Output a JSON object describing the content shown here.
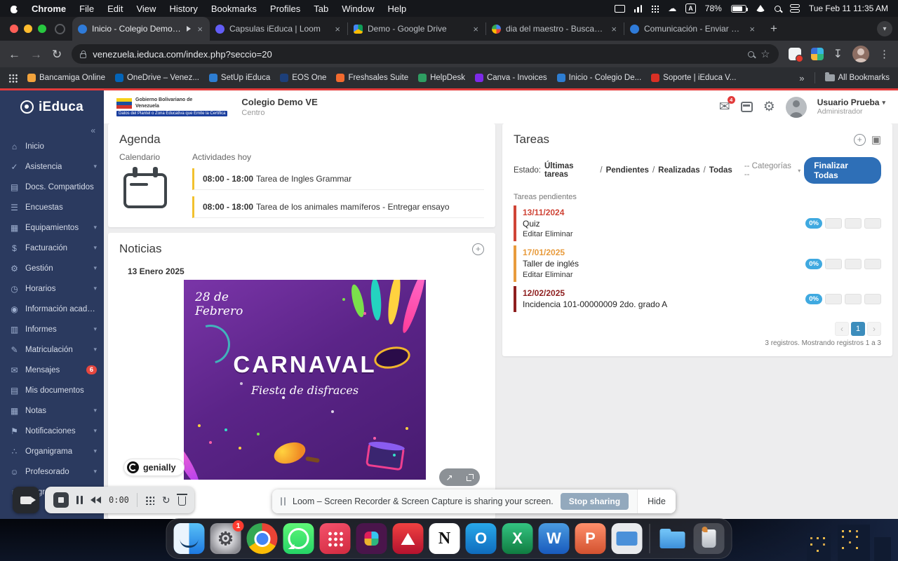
{
  "icons": {
    "caret_down": "▾",
    "more_chevrons": "»",
    "back_arrow": "←",
    "forward_arrow": "→",
    "reload": "↻",
    "star": "☆",
    "download": "↧",
    "kebab": "⋮",
    "plus": "+",
    "close": "×",
    "mail": "✉",
    "gear": "⚙",
    "chevron_left": "‹",
    "chevron_right": "›",
    "collapse": "«",
    "share": "↗",
    "slash": "/",
    "cloud": "☁",
    "refresh": "↻"
  },
  "menubar": {
    "app": "Chrome",
    "menus": [
      "File",
      "Edit",
      "View",
      "History",
      "Bookmarks",
      "Profiles",
      "Tab",
      "Window",
      "Help"
    ],
    "input_source": "A",
    "battery": "78%",
    "clock": "Tue Feb 11 11:35 AM"
  },
  "tabstrip": {
    "tabs": [
      {
        "title": "Inicio - Colegio Demo VE"
      },
      {
        "title": "Capsulas iEduca | Loom"
      },
      {
        "title": "Demo - Google Drive"
      },
      {
        "title": "dia del maestro - Buscar con"
      },
      {
        "title": "Comunicación - Enviar Mens"
      }
    ]
  },
  "toolbar": {
    "url": "venezuela.ieduca.com/index.php?seccio=20"
  },
  "bookmarks": {
    "items": [
      "Bancamiga Online",
      "OneDrive – Venez...",
      "SetUp iEduca",
      "EOS One",
      "Freshsales Suite",
      "HelpDesk",
      "Canva - Invoices",
      "Inicio - Colegio De...",
      "Soporte | iEduca V..."
    ],
    "all": "All Bookmarks"
  },
  "app_header": {
    "logo": "iEduca",
    "gov_title": "Gobierno Bolivariano de Venezuela",
    "gov_subtitle": "Datos del Plantel o Zona Educativa que Emite la Certifica",
    "school_name": "Colegio Demo VE",
    "school_type": "Centro",
    "mail_badge": "4",
    "user_name": "Usuario Prueba",
    "user_role": "Administrador"
  },
  "sidebar": {
    "items": [
      {
        "label": "Inicio",
        "icon": "⌂"
      },
      {
        "label": "Asistencia",
        "icon": "✓"
      },
      {
        "label": "Docs. Compartidos",
        "icon": "▤"
      },
      {
        "label": "Encuestas",
        "icon": "☰"
      },
      {
        "label": "Equipamientos",
        "icon": "▦"
      },
      {
        "label": "Facturación",
        "icon": "$"
      },
      {
        "label": "Gestión",
        "icon": "⚙"
      },
      {
        "label": "Horarios",
        "icon": "◷"
      },
      {
        "label": "Información académica",
        "icon": "◉"
      },
      {
        "label": "Informes",
        "icon": "▥"
      },
      {
        "label": "Matriculación",
        "icon": "✎"
      },
      {
        "label": "Mensajes",
        "icon": "✉",
        "badge": "6"
      },
      {
        "label": "Mis documentos",
        "icon": "▤"
      },
      {
        "label": "Notas",
        "icon": "▦"
      },
      {
        "label": "Notificaciones",
        "icon": "⚑"
      },
      {
        "label": "Organigrama",
        "icon": "∴"
      },
      {
        "label": "Profesorado",
        "icon": "☺"
      },
      {
        "label": "Programación",
        "icon": "≡"
      }
    ]
  },
  "agenda": {
    "title": "Agenda",
    "tab_calendar": "Calendario",
    "tab_today": "Actividades hoy",
    "events": [
      {
        "time": "08:00 - 18:00",
        "text": "Tarea de Ingles Grammar"
      },
      {
        "time": "08:00 - 18:00",
        "text": "Tarea de los animales mamíferos - Entregar ensayo"
      }
    ]
  },
  "noticias": {
    "title": "Noticias",
    "date": "13 Enero 2025",
    "poster": {
      "line1": "28 de Febrero",
      "line2": "CARNAVAL",
      "line3": "Fiesta de disfraces",
      "brand": "genially"
    }
  },
  "tareas": {
    "title": "Tareas",
    "estado_label": "Estado:",
    "filters": [
      "Últimas tareas",
      "Pendientes",
      "Realizadas",
      "Todas"
    ],
    "categorias": "-- Categorías --",
    "finalizar": "Finalizar Todas",
    "pendientes_label": "Tareas pendientes",
    "rows": [
      {
        "date": "13/11/2024",
        "title": "Quiz",
        "actions": "Editar Eliminar",
        "progress": "0%",
        "color": "#cf4436"
      },
      {
        "date": "17/01/2025",
        "title": "Taller de inglés",
        "actions": "Editar Eliminar",
        "progress": "0%",
        "color": "#e89b3c"
      },
      {
        "date": "12/02/2025",
        "title": "Incidencia 101-00000009 2do. grado A",
        "actions": "",
        "progress": "0%",
        "color": "#8e1f1f"
      }
    ],
    "page": "1",
    "footer": "3 registros. Mostrando registros 1 a 3"
  },
  "loom_bar": {
    "message": "Loom – Screen Recorder & Screen Capture is sharing your screen.",
    "stop": "Stop sharing",
    "hide": "Hide"
  },
  "recorder": {
    "time": "0:00"
  },
  "dock": {
    "apps": [
      {
        "name": "finder"
      },
      {
        "name": "system-settings",
        "glyph": "⚙",
        "badge": "1"
      },
      {
        "name": "chrome"
      },
      {
        "name": "whatsapp"
      },
      {
        "name": "launchpad"
      },
      {
        "name": "slack"
      },
      {
        "name": "acrobat"
      },
      {
        "name": "notion",
        "glyph": "N"
      },
      {
        "name": "outlook",
        "glyph": "O"
      },
      {
        "name": "excel",
        "glyph": "X"
      },
      {
        "name": "word",
        "glyph": "W"
      },
      {
        "name": "powerpoint",
        "glyph": "P"
      },
      {
        "name": "screen-mirroring"
      },
      {
        "name": "downloads"
      },
      {
        "name": "trash"
      }
    ]
  }
}
